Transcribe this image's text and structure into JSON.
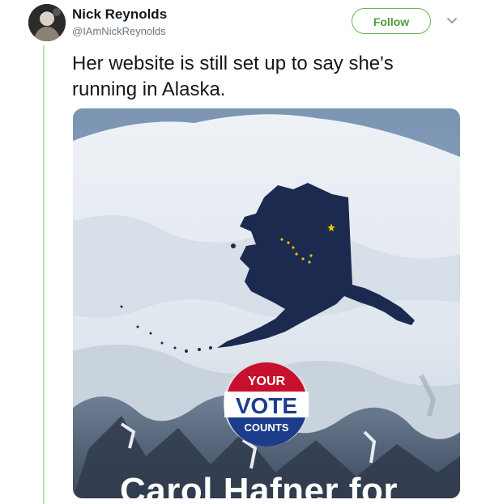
{
  "user": {
    "display_name": "Nick Reynolds",
    "handle": "@IAmNickReynolds"
  },
  "actions": {
    "follow_label": "Follow",
    "more_icon": "chevron-down-icon"
  },
  "tweet": {
    "text": "Her website is still set up to say she's running in Alaska."
  },
  "media": {
    "badge": {
      "line1": "YOUR",
      "line2": "VOTE",
      "line3": "COUNTS"
    },
    "caption": "Carol Hafner for"
  },
  "colors": {
    "follow_accent": "#4f9b3a",
    "thread_line": "#c4e3bc",
    "alaska_fill": "#1b2a4e",
    "star_gold": "#f2c200",
    "badge_red": "#c8102e",
    "badge_blue": "#1d3c8c"
  }
}
